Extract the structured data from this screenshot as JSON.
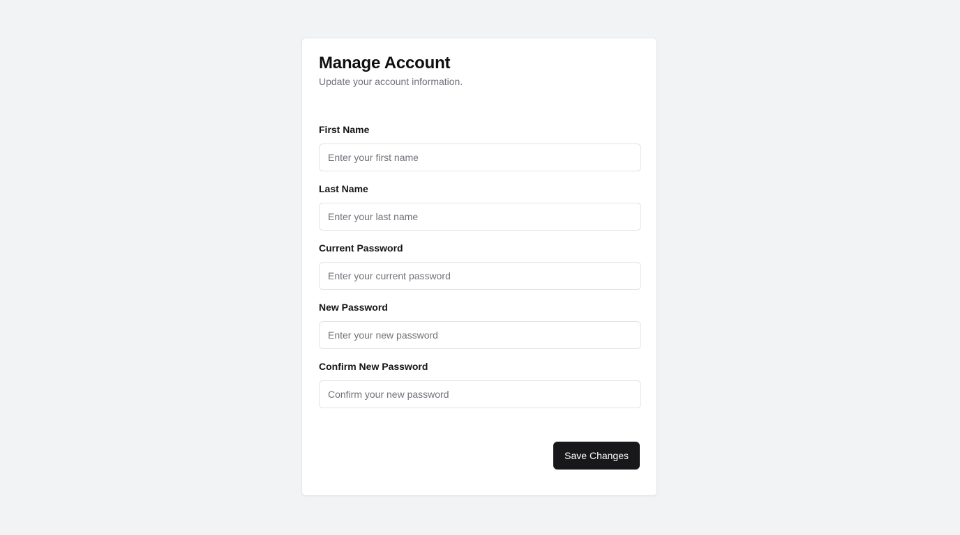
{
  "card": {
    "title": "Manage Account",
    "subtitle": "Update your account information."
  },
  "form": {
    "fields": [
      {
        "label": "First Name",
        "placeholder": "Enter your first name",
        "value": ""
      },
      {
        "label": "Last Name",
        "placeholder": "Enter your last name",
        "value": ""
      },
      {
        "label": "Current Password",
        "placeholder": "Enter your current password",
        "value": ""
      },
      {
        "label": "New Password",
        "placeholder": "Enter your new password",
        "value": ""
      },
      {
        "label": "Confirm New Password",
        "placeholder": "Confirm your new password",
        "value": ""
      }
    ],
    "submit_label": "Save Changes"
  },
  "colors": {
    "page_background": "#f2f3f5",
    "card_background": "#ffffff",
    "primary_button": "#18181b",
    "muted_text": "#71717a"
  }
}
